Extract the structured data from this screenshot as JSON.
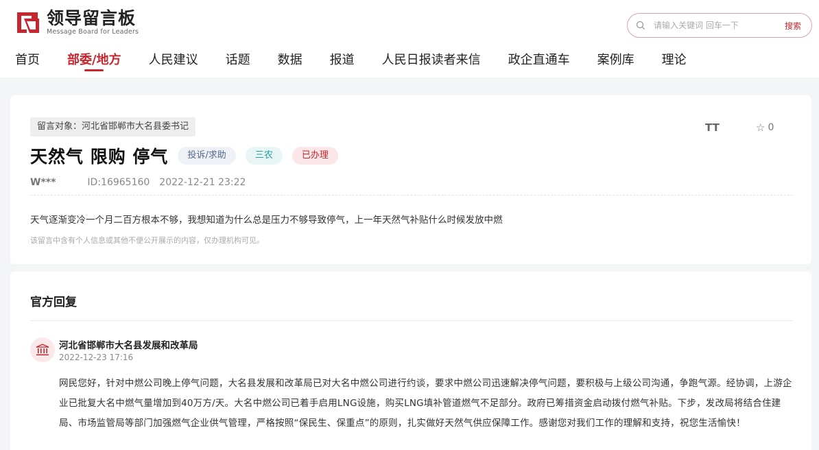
{
  "header": {
    "logo_cn": "领导留言板",
    "logo_en": "Message Board for Leaders",
    "search_placeholder": "请输入关键词 回车一下",
    "search_button": "搜索"
  },
  "nav": {
    "items": [
      "首页",
      "部委/地方",
      "人民建议",
      "话题",
      "数据",
      "报道",
      "人民日报读者来信",
      "政企直通车",
      "案例库",
      "理论"
    ],
    "active_index": 1
  },
  "message": {
    "target": "留言对象：河北省邯郸市大名县委书记",
    "title": "天然气 限购 停气",
    "tags": {
      "type": "投诉/求助",
      "category": "三农",
      "status": "已办理"
    },
    "author": "W***",
    "id": "ID:16965160",
    "datetime": "2022-12-21 23:22",
    "font_size_toggle": "TT",
    "favorite_count": "0",
    "content": "天气逐渐变冷一个月二百方根本不够，我想知道为什么总是压力不够导致停气，上一年天然气补贴什么时候发放中燃",
    "privacy_note": "该留言中含有个人信息或其他不便公开展示的内容，仅办理机构可见。"
  },
  "reply": {
    "heading": "官方回复",
    "org": "河北省邯郸市大名县发展和改革局",
    "datetime": "2022-12-23 17:16",
    "body": "网民您好，针对中燃公司晚上停气问题，大名县发展和改革局已对大名中燃公司进行约谈，要求中燃公司迅速解决停气问题，要积极与上级公司沟通，争跑气源。经协调，上游企业已批复大名中燃气量增加到40万方/天。大名中燃公司已着手启用LNG设施，购买LNG填补管道燃气不足部分。政府已筹措资金启动拨付燃气补贴。下步，发改局将结合住建局、市场监管局等部门加强燃气企业供气管理，严格按照“保民生、保重点”的原则，扎实做好天然气供应保障工作。感谢您对我们工作的理解和支持，祝您生活愉快！"
  },
  "colors": {
    "brand": "#c6262d"
  }
}
